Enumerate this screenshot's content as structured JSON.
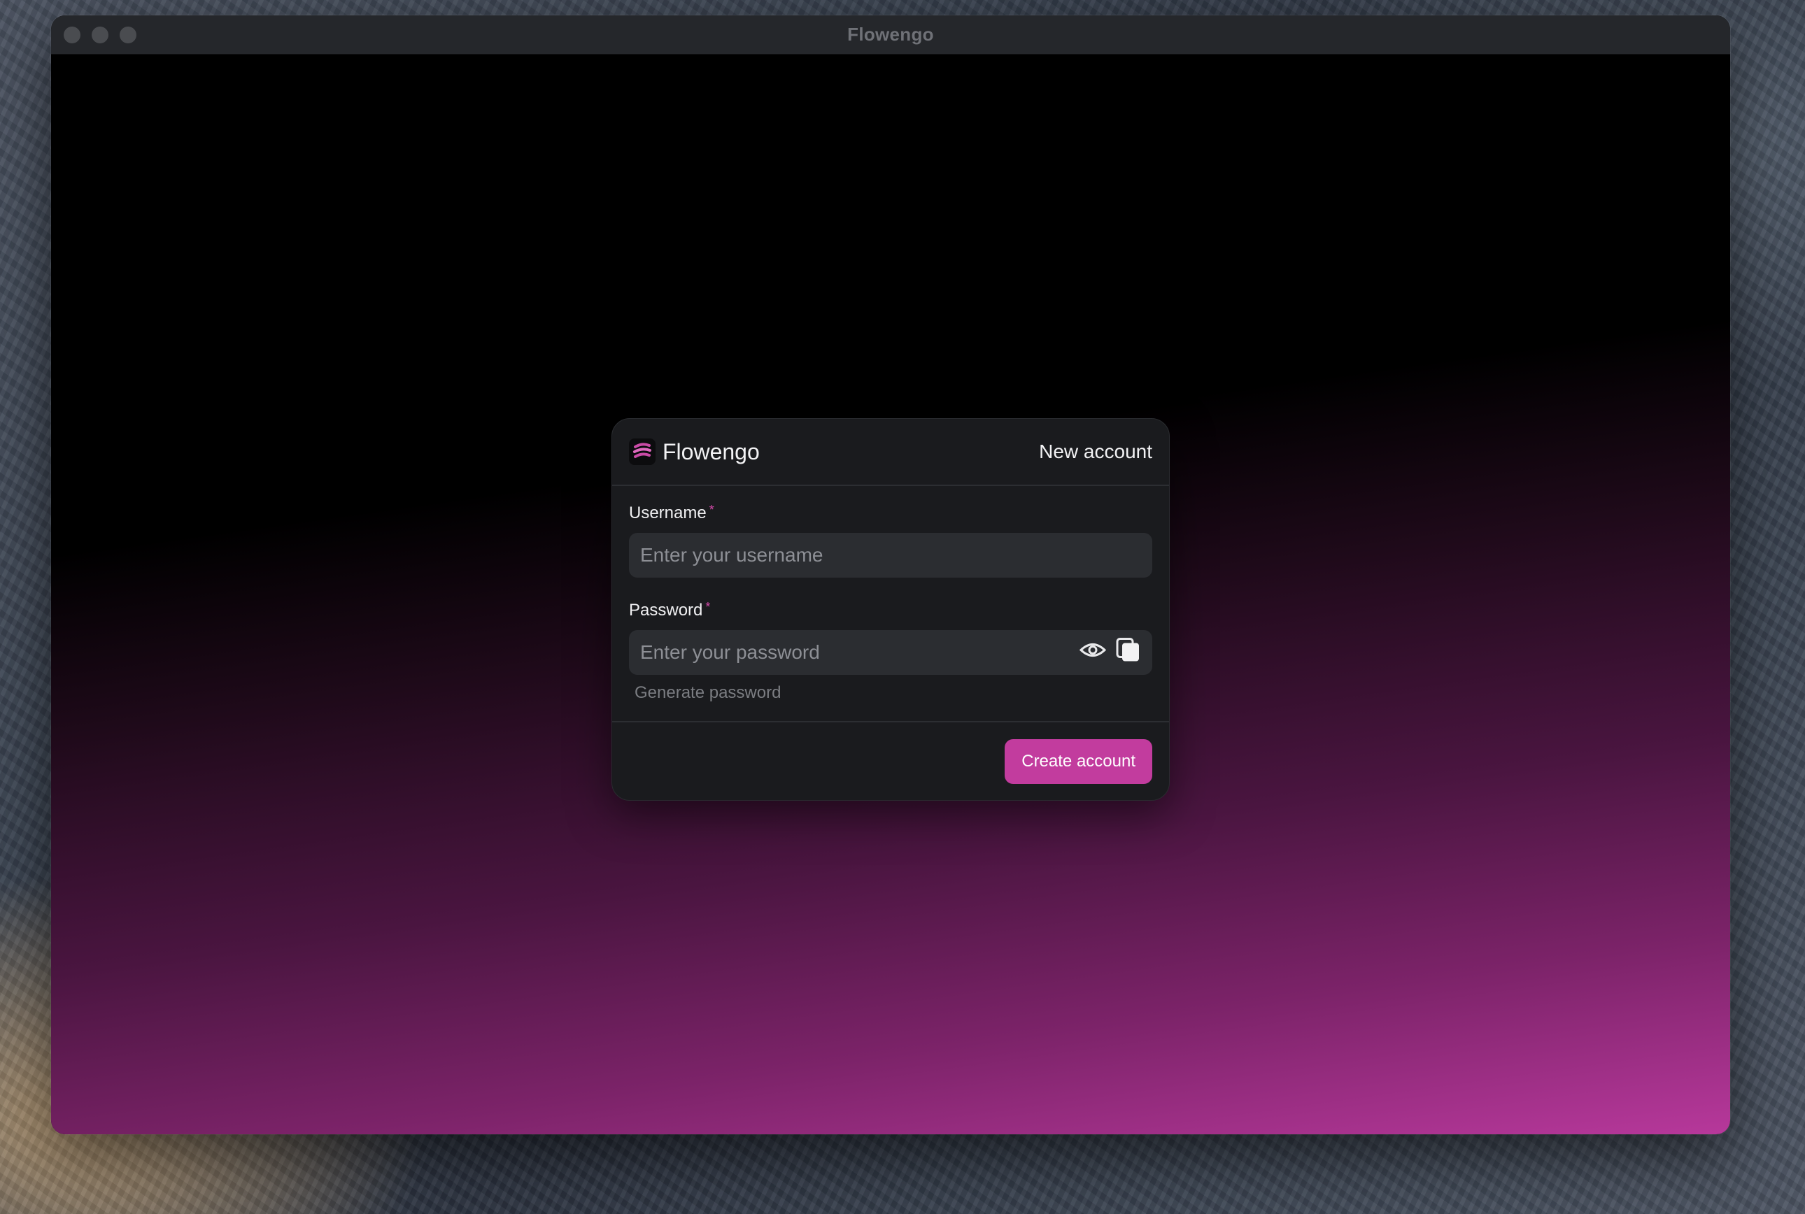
{
  "window": {
    "title": "Flowengo"
  },
  "card": {
    "brand_name": "Flowengo",
    "header_title": "New account",
    "username": {
      "label": "Username",
      "required_mark": "*",
      "placeholder": "Enter your username"
    },
    "password": {
      "label": "Password",
      "required_mark": "*",
      "placeholder": "Enter your password"
    },
    "generate_password_label": "Generate password",
    "submit_label": "Create account"
  },
  "icons": {
    "logo": "flowengo-logo-icon",
    "show_password": "eye-icon",
    "copy_password": "copy-icon"
  },
  "colors": {
    "accent": "#c23c9e",
    "card_bg": "#1a1b1e",
    "input_bg": "#2b2d31",
    "required": "#d04aa8"
  }
}
